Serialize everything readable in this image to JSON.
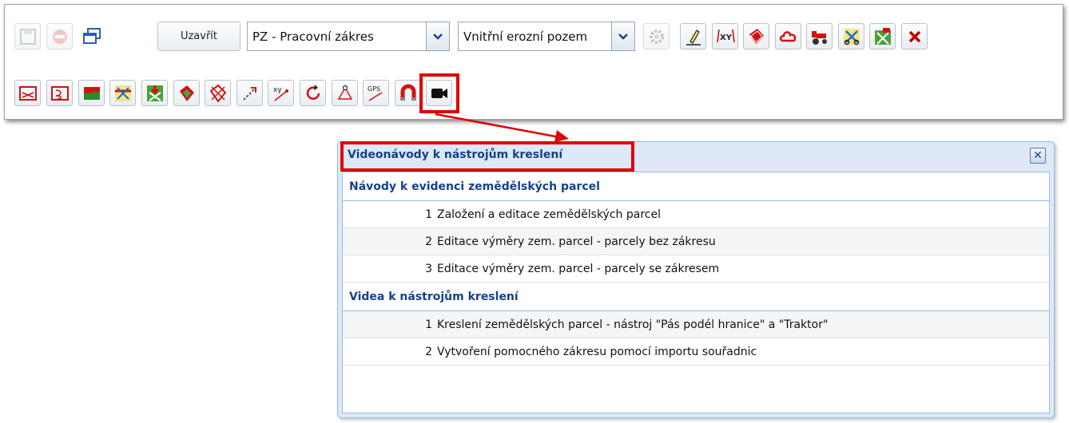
{
  "toolbar": {
    "close_label": "Uzavřít",
    "select1_value": "PZ - Pracovní zákres",
    "select2_value": "Vnitřní erozní pozem"
  },
  "panel": {
    "title": "Videonávody k nástrojům kreslení",
    "close_glyph": "✕",
    "sections": [
      {
        "title": "Návody k evidenci zemědělských parcel",
        "items": [
          {
            "num": "1",
            "label": "Založení a editace zemědělských parcel"
          },
          {
            "num": "2",
            "label": "Editace výměry zem. parcel - parcely bez zákresu"
          },
          {
            "num": "3",
            "label": "Editace výměry zem. parcel - parcely se zákresem"
          }
        ]
      },
      {
        "title": "Videa k nástrojům kreslení",
        "items": [
          {
            "num": "1",
            "label": "Kreslení zemědělských parcel - nástroj \"Pás podél hranice\" a \"Traktor\""
          },
          {
            "num": "2",
            "label": "Vytvoření pomocného zákresu pomocí importu souřadnic"
          }
        ]
      }
    ]
  },
  "colors": {
    "highlight": "#e00000",
    "panel_title": "#15428b",
    "panel_border": "#99bbe8"
  }
}
